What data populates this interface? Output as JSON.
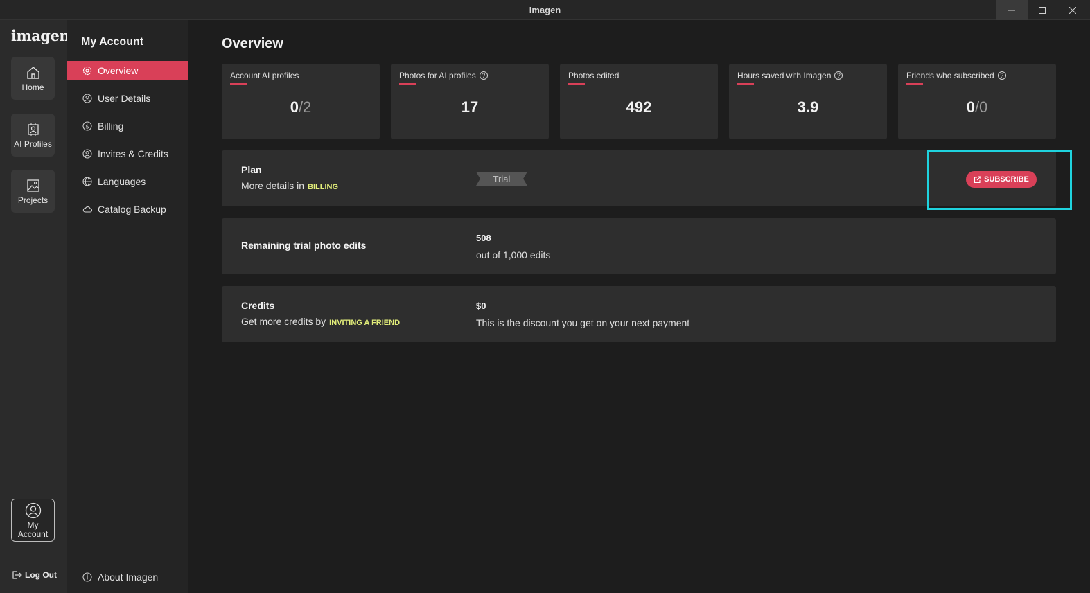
{
  "window": {
    "title": "Imagen"
  },
  "rail": {
    "logo": "imagen",
    "items": [
      {
        "label": "Home",
        "icon": "home-icon"
      },
      {
        "label": "AI Profiles",
        "icon": "ai-profiles-icon"
      },
      {
        "label": "Projects",
        "icon": "projects-icon"
      }
    ],
    "account_line1": "My",
    "account_line2": "Account",
    "logout": "Log Out"
  },
  "nav": {
    "title": "My Account",
    "items": [
      {
        "label": "Overview",
        "icon": "gear-icon",
        "active": true
      },
      {
        "label": "User Details",
        "icon": "user-icon"
      },
      {
        "label": "Billing",
        "icon": "dollar-icon"
      },
      {
        "label": "Invites & Credits",
        "icon": "invite-icon"
      },
      {
        "label": "Languages",
        "icon": "globe-icon"
      },
      {
        "label": "Catalog Backup",
        "icon": "cloud-icon"
      }
    ],
    "about": "About Imagen"
  },
  "main": {
    "title": "Overview",
    "stats": [
      {
        "label": "Account AI profiles",
        "value": "0",
        "total": "/2",
        "help": false
      },
      {
        "label": "Photos for AI profiles",
        "value": "17",
        "total": "",
        "help": true
      },
      {
        "label": "Photos edited",
        "value": "492",
        "total": "",
        "help": false
      },
      {
        "label": "Hours saved with Imagen",
        "value": "3.9",
        "total": "",
        "help": true
      },
      {
        "label": "Friends who subscribed",
        "value": "0",
        "total": "/0",
        "help": true
      }
    ],
    "plan": {
      "title": "Plan",
      "sub": "More details in",
      "link": "BILLING",
      "badge": "Trial",
      "button": "SUBSCRIBE"
    },
    "remaining": {
      "title": "Remaining trial photo edits",
      "value": "508",
      "desc": "out of 1,000 edits"
    },
    "credits": {
      "title": "Credits",
      "sub": "Get more credits by",
      "link": "INVITING A FRIEND",
      "value": "$0",
      "desc": "This is the discount you get on your next payment"
    }
  },
  "colors": {
    "accent": "#d94058",
    "link": "#e3ef7a",
    "highlight": "#1fd3de"
  }
}
